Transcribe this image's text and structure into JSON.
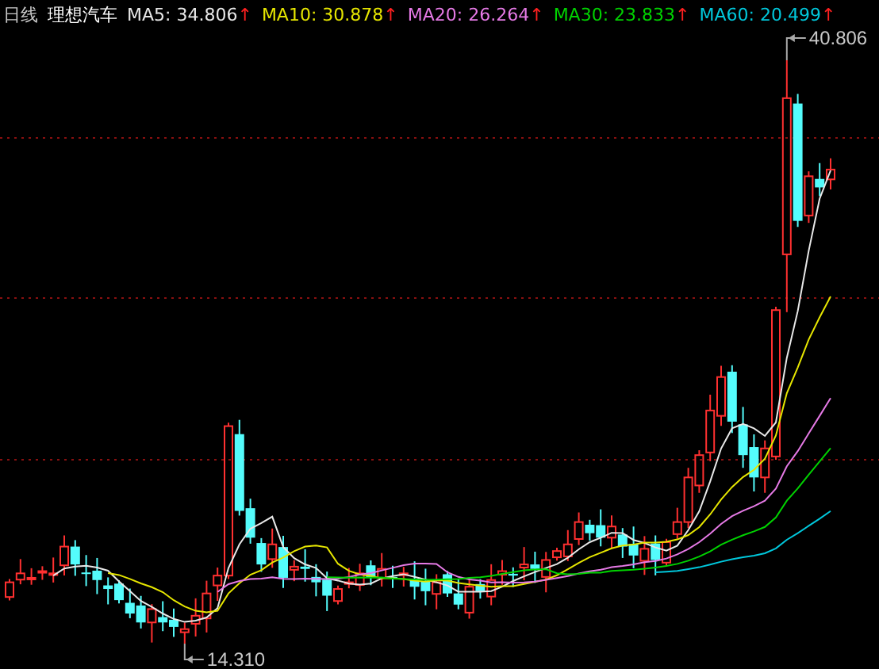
{
  "header": {
    "period": "日线",
    "name": "理想汽车",
    "indicators": [
      {
        "label": "MA5: 34.806",
        "color": "#e8e8e8",
        "arrow": "↑"
      },
      {
        "label": "MA10: 30.878",
        "color": "#e6e600",
        "arrow": "↑"
      },
      {
        "label": "MA20: 26.264",
        "color": "#e67ae6",
        "arrow": "↑"
      },
      {
        "label": "MA30: 23.833",
        "color": "#00d200",
        "arrow": "↑"
      },
      {
        "label": "MA60: 20.499",
        "color": "#00c8dc",
        "arrow": "↑"
      }
    ]
  },
  "chart": {
    "high_label": "40.806",
    "low_label": "14.310"
  }
}
